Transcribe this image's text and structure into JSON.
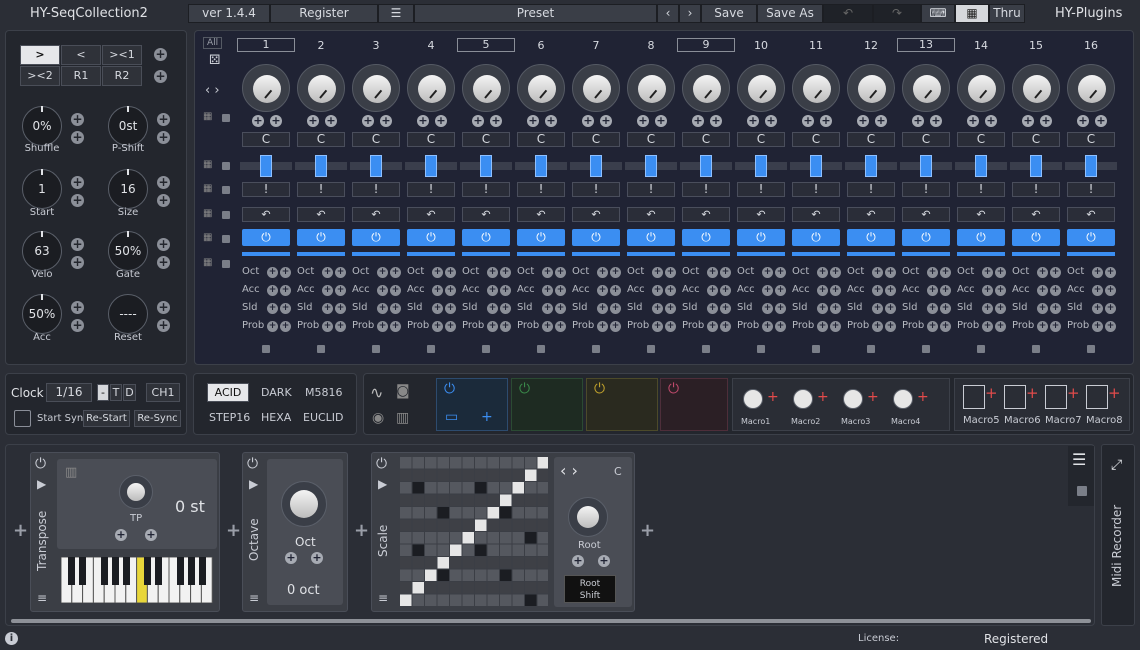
{
  "app": {
    "title": "HY-SeqCollection2",
    "brand": "HY-Plugins",
    "version": "ver 1.4.4",
    "register": "Register",
    "preset_label": "Preset",
    "save": "Save",
    "save_as": "Save As",
    "thru": "Thru"
  },
  "left_buttons": [
    ">",
    "<",
    "><1",
    "><2",
    "R1",
    "R2"
  ],
  "knobs": [
    {
      "value": "0%",
      "label": "Shuffle"
    },
    {
      "value": "0st",
      "label": "P-Shift"
    },
    {
      "value": "1",
      "label": "Start"
    },
    {
      "value": "16",
      "label": "Size"
    },
    {
      "value": "63",
      "label": "Velo"
    },
    {
      "value": "50%",
      "label": "Gate"
    },
    {
      "value": "50%",
      "label": "Acc"
    },
    {
      "value": "----",
      "label": "Reset"
    }
  ],
  "sequencer": {
    "all_label": "All",
    "steps": [
      "1",
      "2",
      "3",
      "4",
      "5",
      "6",
      "7",
      "8",
      "9",
      "10",
      "11",
      "12",
      "13",
      "14",
      "15",
      "16"
    ],
    "boxed_steps": [
      1,
      5,
      9,
      13
    ],
    "note": "C",
    "gate_symbol": "!",
    "row_labels": [
      "Oct",
      "Acc",
      "Sld",
      "Prob"
    ],
    "power_symbol": "⏻"
  },
  "clock": {
    "label": "Clock",
    "value": "1/16",
    "dash": "-",
    "t": "T",
    "d": "D",
    "channel": "CH1",
    "start_sync": "Start Sync",
    "restart": "Re-Start",
    "resync": "Re-Sync"
  },
  "modes": [
    "ACID",
    "DARK",
    "M5816",
    "STEP16",
    "HEXA",
    "EUCLID"
  ],
  "active_mode": "ACID",
  "macros": [
    "Macro1",
    "Macro2",
    "Macro3",
    "Macro4"
  ],
  "macros_big": [
    "Macro5",
    "Macro6",
    "Macro7",
    "Macro8"
  ],
  "modules": {
    "transpose": {
      "name": "Transpose",
      "value": "0 st",
      "knob": "TP"
    },
    "octave": {
      "name": "Octave",
      "knob": "Oct",
      "value": "0 oct"
    },
    "scale": {
      "name": "Scale",
      "note": "C",
      "knob": "Root",
      "shift1": "Root",
      "shift2": "Shift"
    }
  },
  "midi_recorder": "Midi Recorder",
  "footer": {
    "license_label": "License:",
    "license_value": "Registered"
  },
  "colors": {
    "accent": "#3b8ef2",
    "background": "#2b2e36",
    "panel": "#23262d",
    "seq_bg": "#202334"
  }
}
